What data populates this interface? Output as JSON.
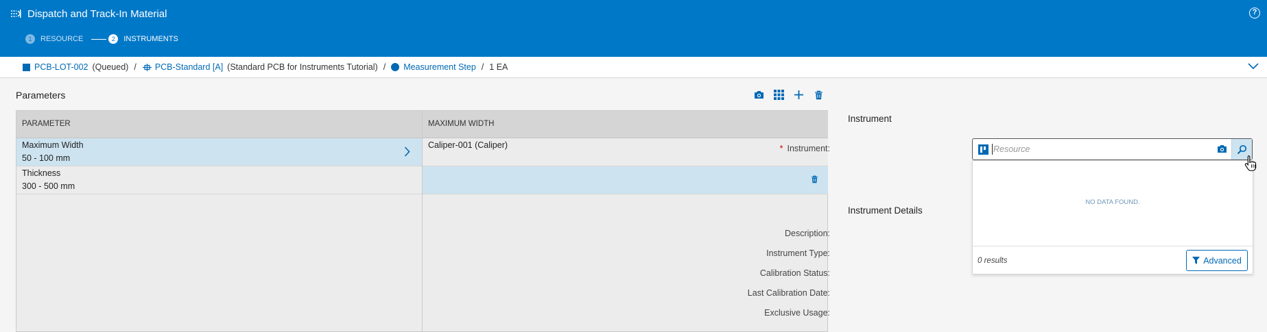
{
  "header": {
    "title": "Dispatch and Track-In Material",
    "help_label": "?",
    "steps": [
      {
        "number": "1",
        "label": "RESOURCE"
      },
      {
        "number": "2",
        "label": "INSTRUMENTS"
      }
    ]
  },
  "breadcrumb": {
    "lot": "PCB-LOT-002",
    "lot_state": "(Queued)",
    "product": "PCB-Standard [A]",
    "product_desc": "(Standard PCB for Instruments Tutorial)",
    "step": "Measurement Step",
    "quantity": "1 EA",
    "separator": "/"
  },
  "parameters": {
    "title": "Parameters",
    "columns": [
      "PARAMETER",
      "MAXIMUM WIDTH"
    ],
    "rows": [
      {
        "name": "Maximum Width",
        "range": "50 - 100 mm",
        "value": "Caliper-001 (Caliper)"
      },
      {
        "name": "Thickness",
        "range": "300 - 500 mm",
        "value": ""
      }
    ]
  },
  "instrument": {
    "section_title": "Instrument",
    "label": "Instrument:",
    "required_mark": "*",
    "placeholder": "Resource",
    "dropdown": {
      "no_data": "NO DATA FOUND.",
      "results": "0 results",
      "advanced_label": "Advanced"
    }
  },
  "instrument_details": {
    "section_title": "Instrument Details",
    "fields": [
      "Description:",
      "Instrument Type:",
      "Calibration Status:",
      "Last Calibration Date:",
      "Exclusive Usage:"
    ]
  },
  "colors": {
    "header": "#0078c8",
    "accent": "#0069b4",
    "selected_row": "#cde3f0"
  }
}
